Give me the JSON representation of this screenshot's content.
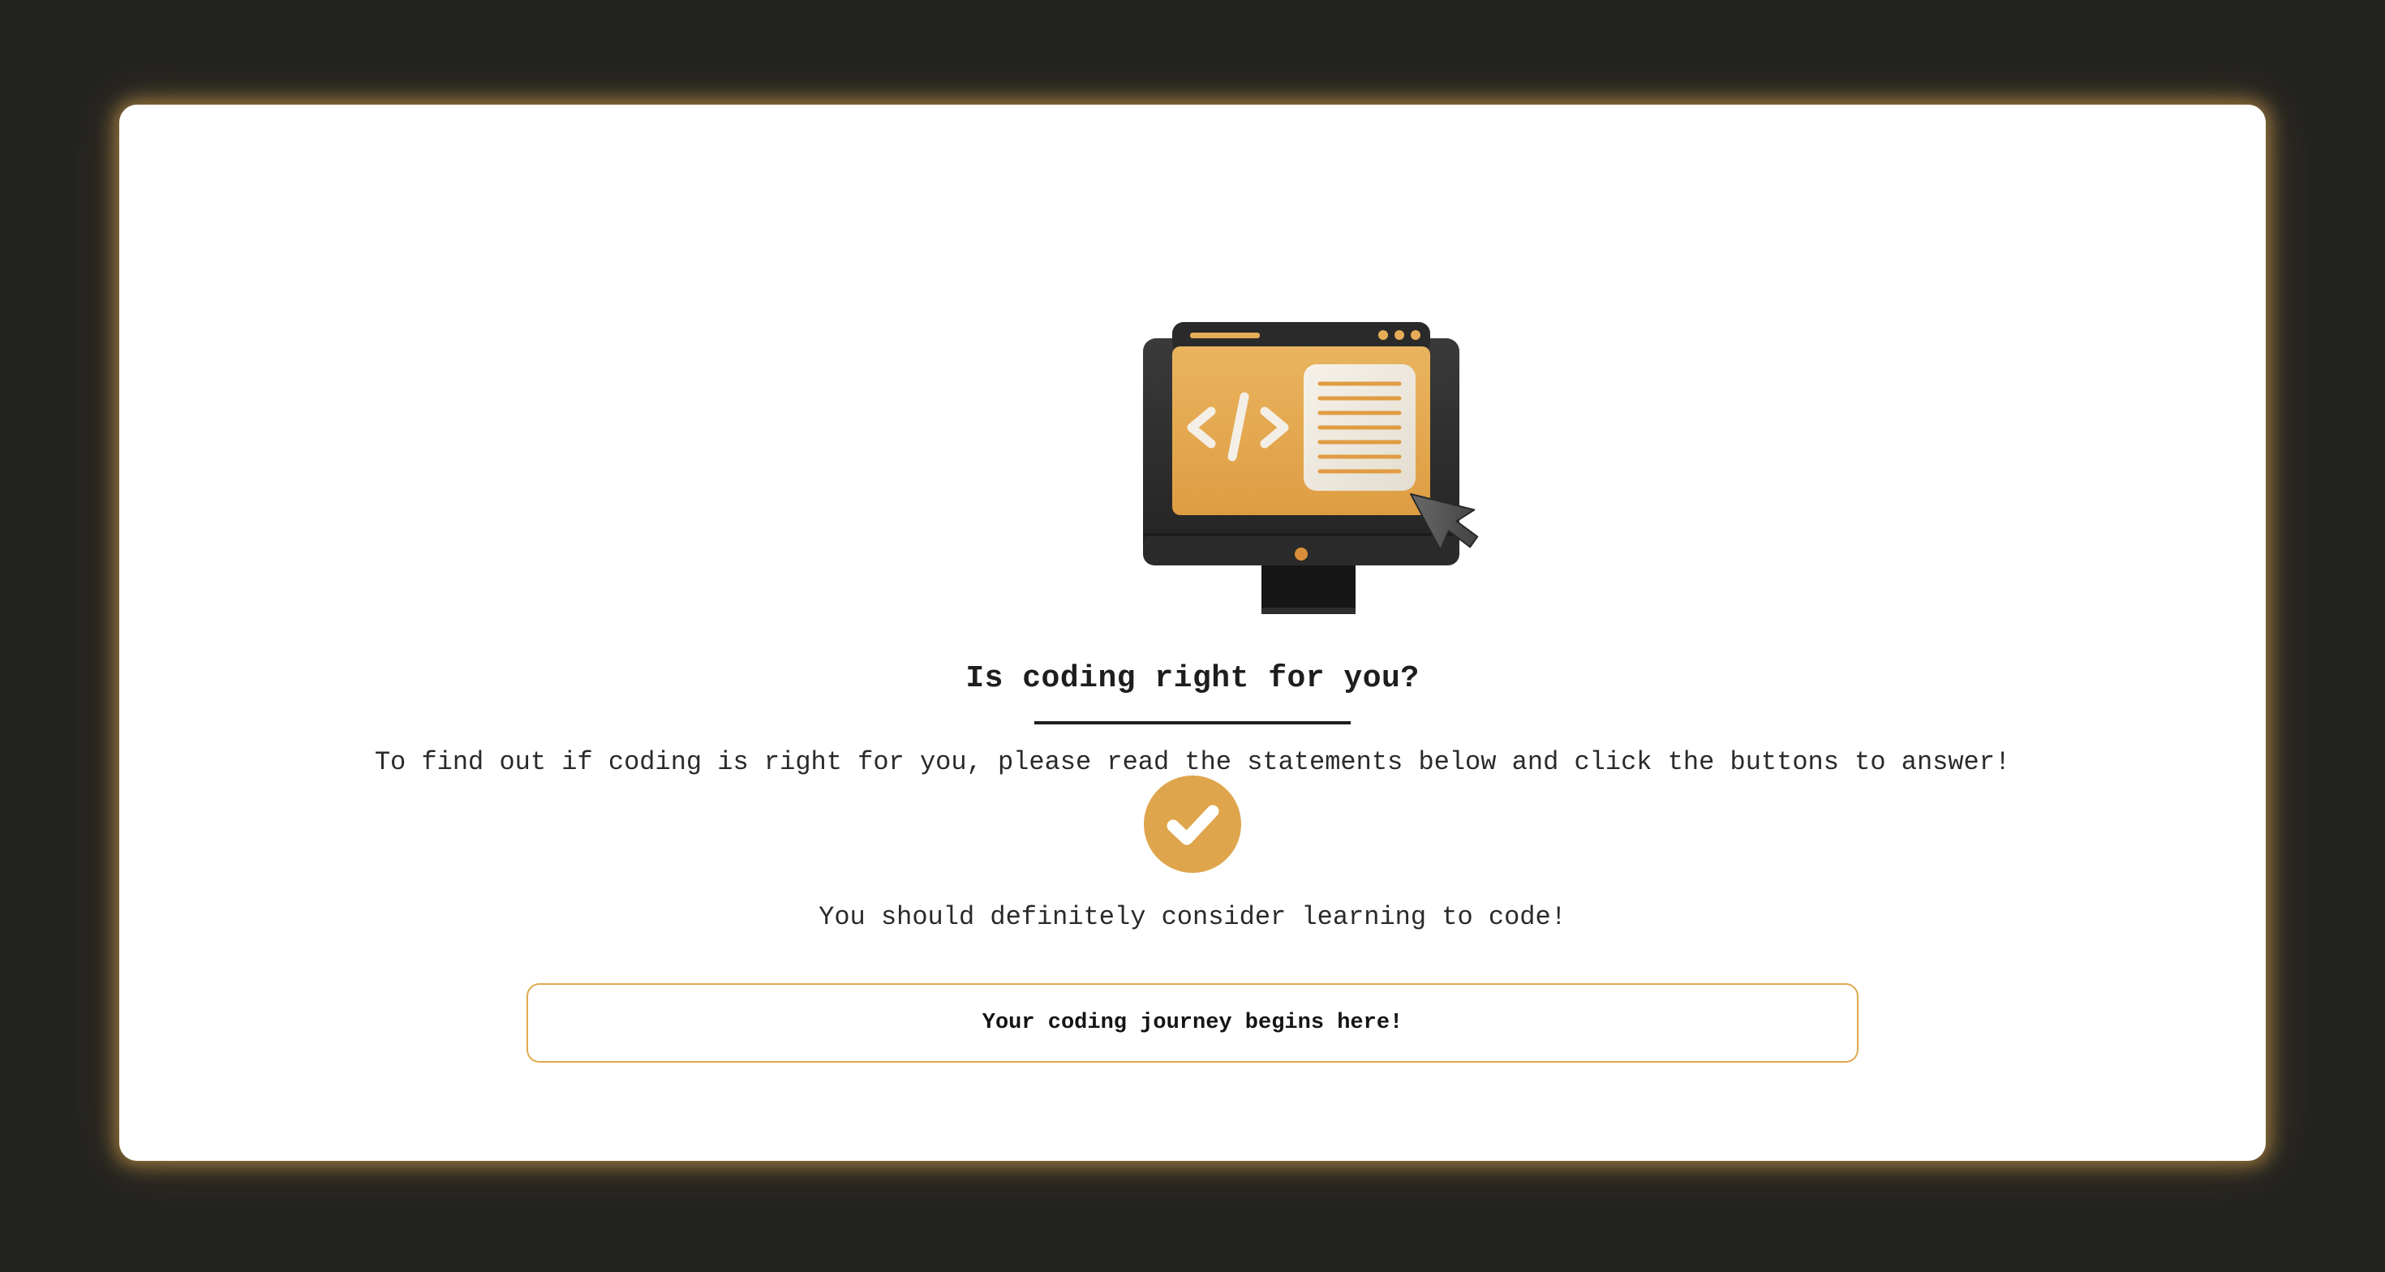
{
  "quiz": {
    "title": "Is coding right for you?",
    "intro": "To find out if coding is right for you, please read the statements below and click the buttons to answer!",
    "result_text": "You should definitely consider learning to code!",
    "cta_label": "Your coding journey begins here!"
  },
  "icons": {
    "hero": "computer-code-document-illustration",
    "result": "checkmark-circle-icon"
  },
  "colors": {
    "page_background": "#222220",
    "card_background": "#ffffff",
    "accent": "#dfa54c",
    "text": "#1e1e1e"
  }
}
